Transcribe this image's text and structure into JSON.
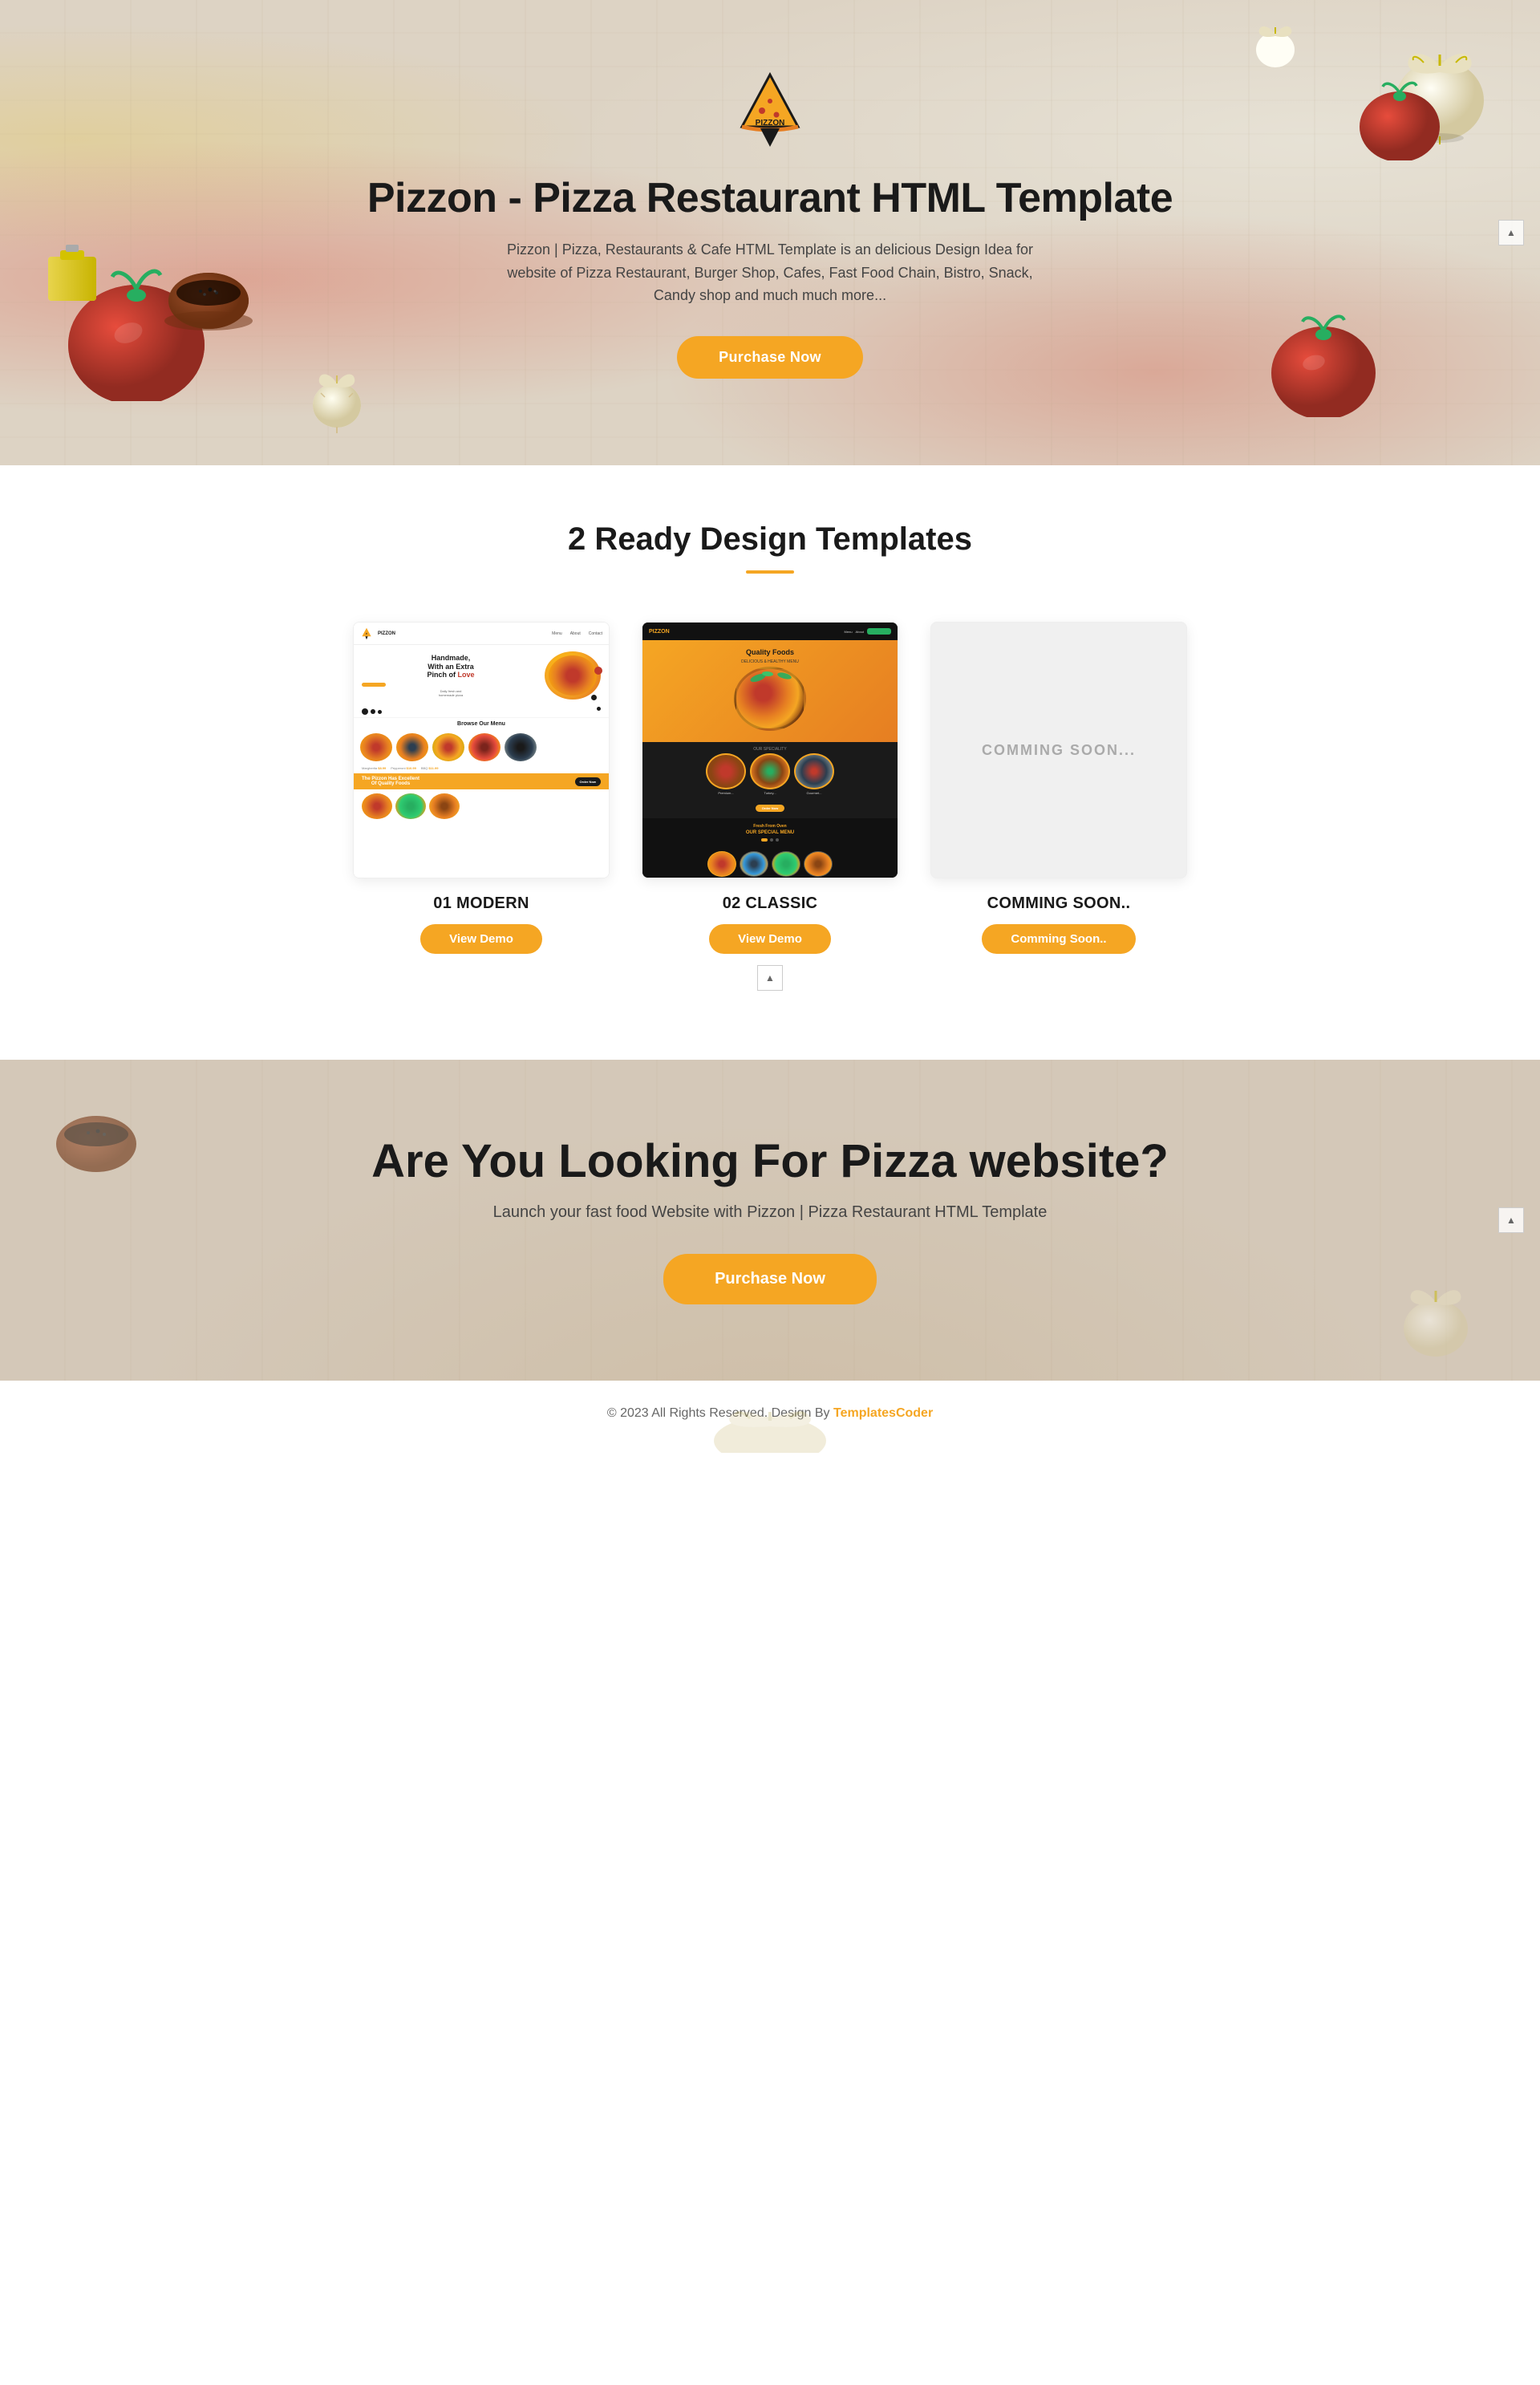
{
  "hero": {
    "logo_text": "PIZZON",
    "title": "Pizzon - Pizza Restaurant HTML Template",
    "description": "Pizzon | Pizza, Restaurants & Cafe HTML Template is an delicious Design Idea for website of Pizza Restaurant, Burger Shop, Cafes, Fast Food Chain, Bistro, Snack, Candy shop and much much more...",
    "purchase_btn": "Purchase Now"
  },
  "templates_section": {
    "title": "2 Ready Design Templates",
    "cards": [
      {
        "number": "01 MODERN",
        "btn_label": "View Demo",
        "type": "modern"
      },
      {
        "number": "02 CLASSIC",
        "btn_label": "View Demo",
        "type": "classic"
      },
      {
        "number": "COMMING SOON..",
        "btn_label": "Comming Soon..",
        "type": "coming_soon",
        "preview_text": "COMMING SOON..."
      }
    ]
  },
  "cta_section": {
    "title": "Are You Looking For Pizza website?",
    "description": "Launch your fast food Website with Pizzon | Pizza Restaurant HTML Template",
    "purchase_btn": "Purchase Now"
  },
  "footer": {
    "text": "© 2023 All Rights Reserved. Design By ",
    "link_text": "TemplatesCoder",
    "link_suffix": ""
  },
  "scroll_buttons": {
    "icon": "▲"
  },
  "colors": {
    "accent": "#f5a623",
    "dark": "#1a1a1a",
    "light_bg": "#d4c8b8"
  }
}
